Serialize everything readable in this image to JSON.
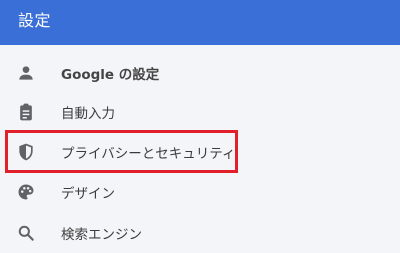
{
  "header": {
    "title": "設定"
  },
  "menu": {
    "items": [
      {
        "label": "Google の設定",
        "icon": "person-icon"
      },
      {
        "label": "自動入力",
        "icon": "clipboard-icon"
      },
      {
        "label": "プライバシーとセキュリティ",
        "icon": "shield-icon"
      },
      {
        "label": "デザイン",
        "icon": "palette-icon"
      },
      {
        "label": "検索エンジン",
        "icon": "search-icon"
      }
    ]
  },
  "colors": {
    "header_bg": "#3a6fd8",
    "highlight_border": "#e0202a",
    "icon": "#5f6368"
  }
}
